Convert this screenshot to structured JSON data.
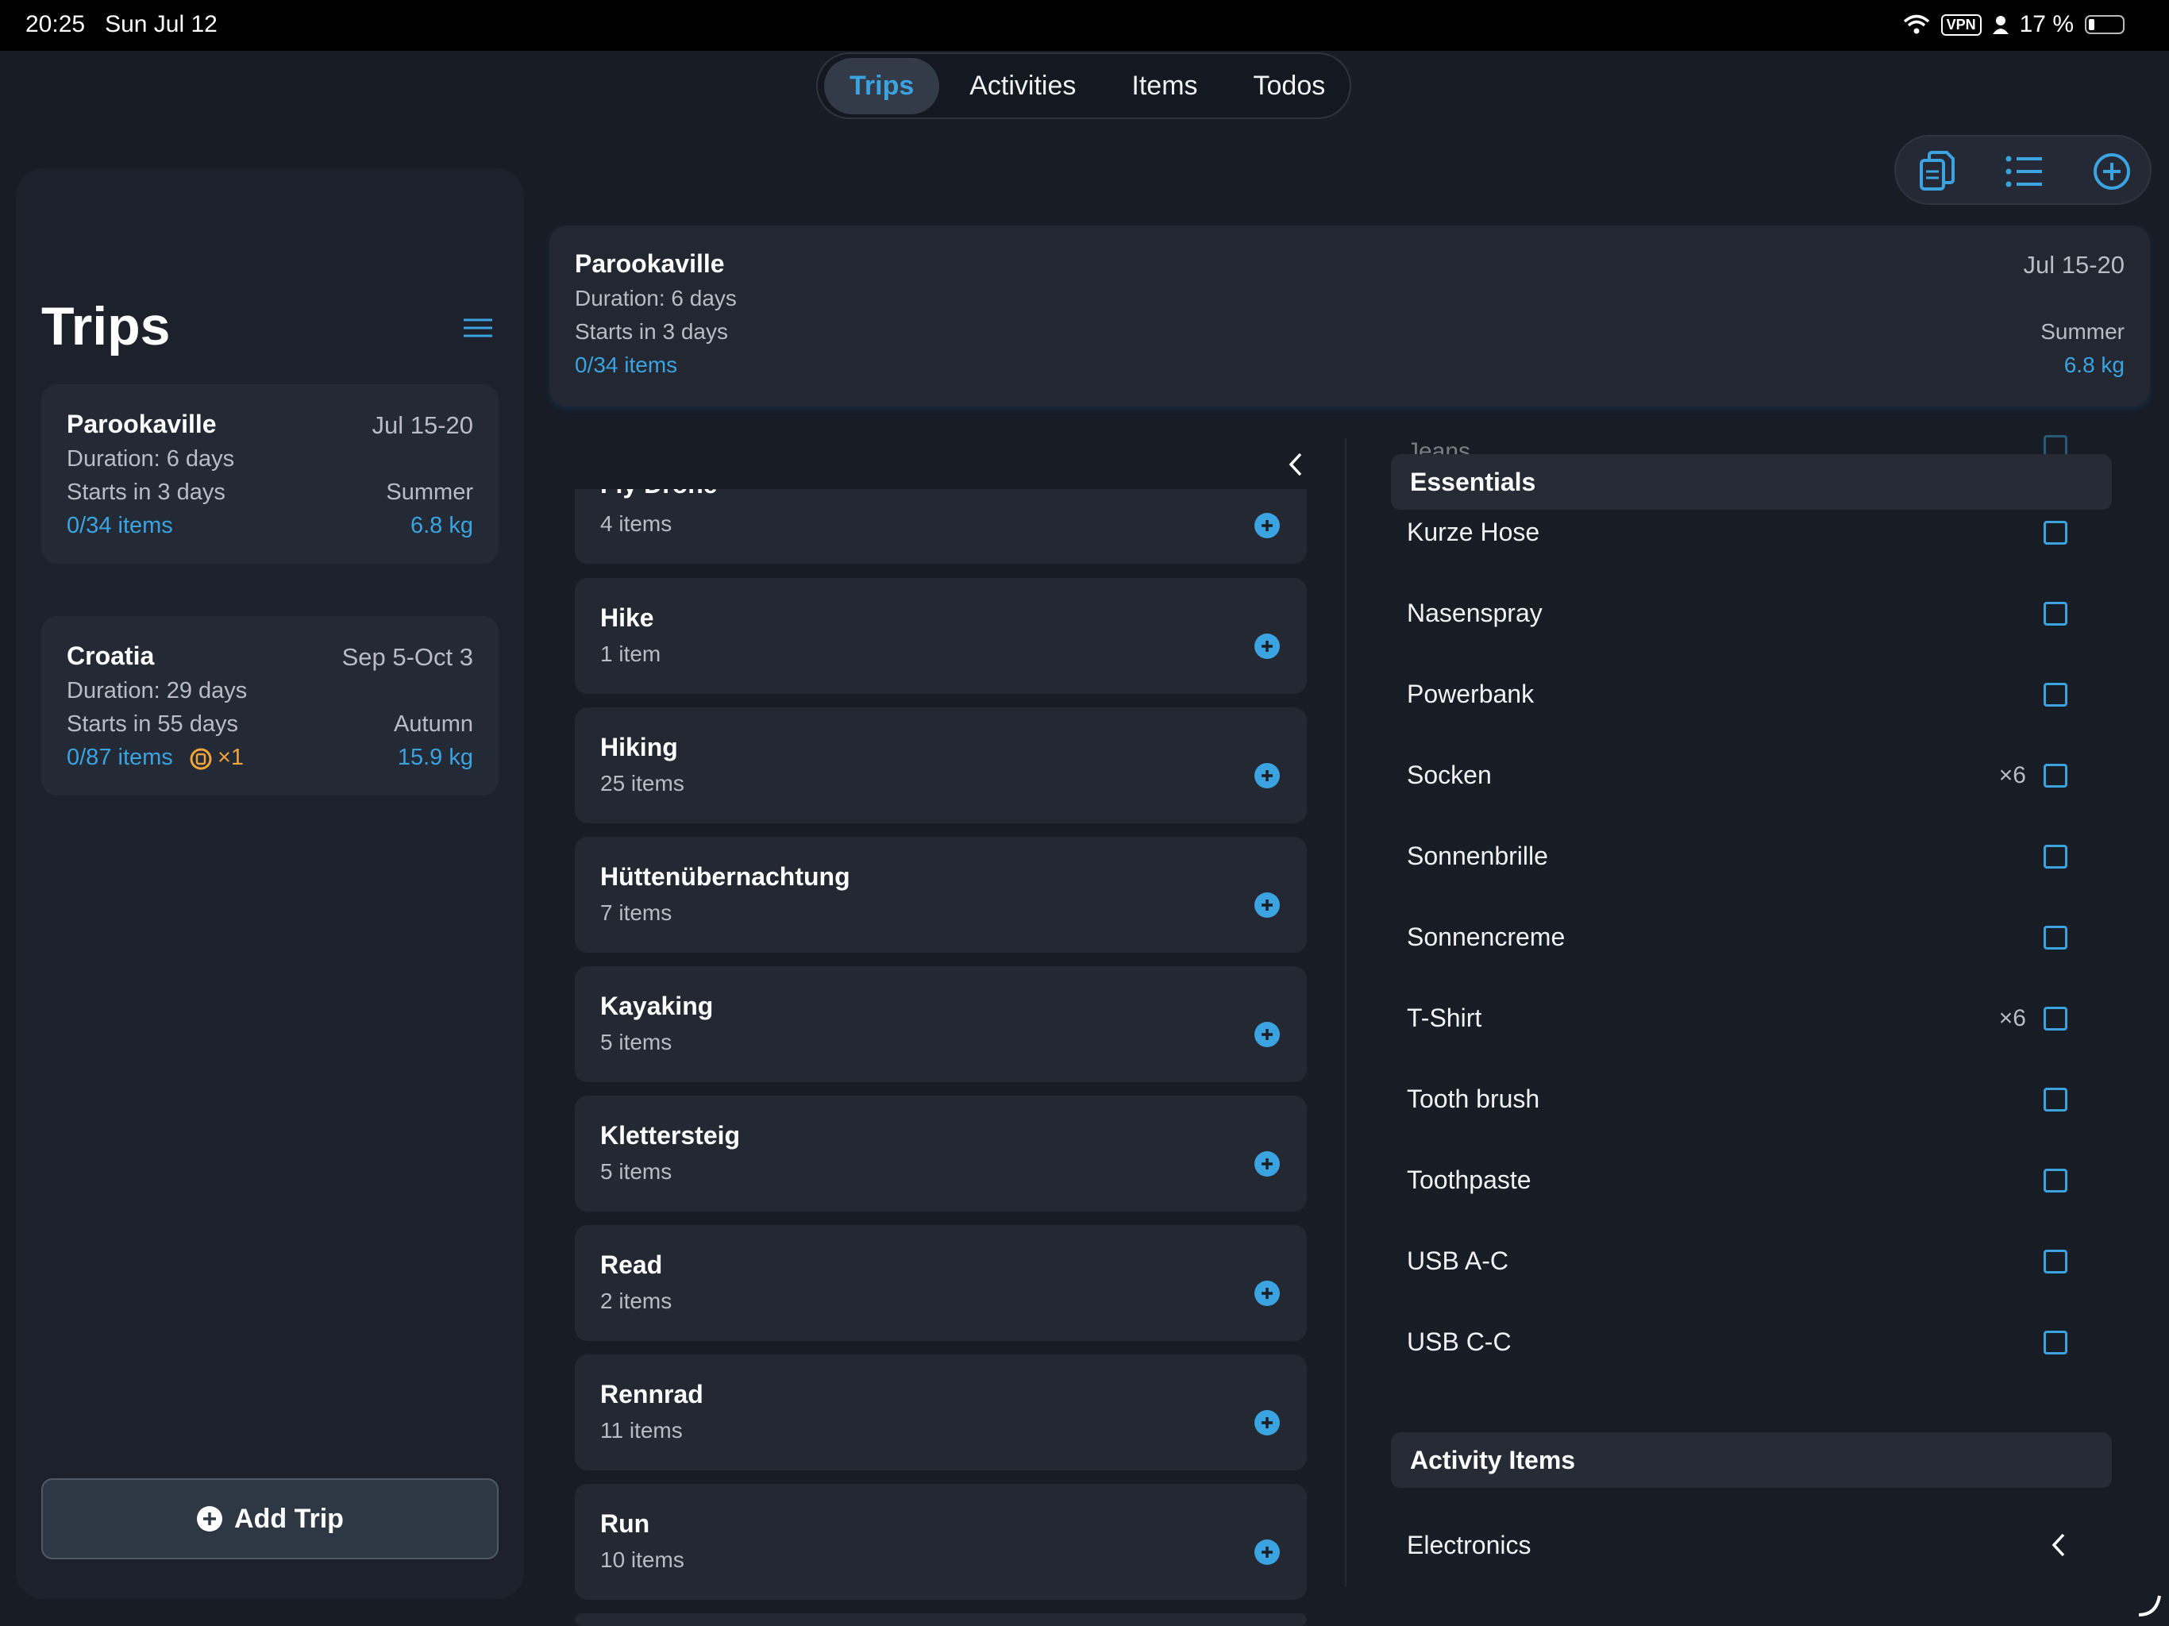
{
  "status_bar": {
    "time": "20:25",
    "date": "Sun Jul 12",
    "vpn": "VPN",
    "battery": "17 %"
  },
  "tabs": [
    {
      "label": "Trips",
      "active": true
    },
    {
      "label": "Activities",
      "active": false
    },
    {
      "label": "Items",
      "active": false
    },
    {
      "label": "Todos",
      "active": false
    }
  ],
  "toolbar": {
    "icons": [
      "copy-documents-icon",
      "list-icon",
      "plus-circle-icon"
    ]
  },
  "sidebar": {
    "title": "Trips",
    "trips": [
      {
        "name": "Parookaville",
        "dates": "Jul 15-20",
        "duration": "Duration: 6 days",
        "starts": "Starts in 3 days",
        "season": "Summer",
        "items": "0/34 items",
        "weight": "6.8 kg"
      },
      {
        "name": "Croatia",
        "dates": "Sep 5-Oct 3",
        "duration": "Duration: 29 days",
        "starts": "Starts in 55 days",
        "season": "Autumn",
        "items": "0/87 items",
        "badge": "×1",
        "weight": "15.9 kg"
      }
    ],
    "add_trip": "Add Trip"
  },
  "detail": {
    "name": "Parookaville",
    "dates": "Jul 15-20",
    "duration": "Duration: 6 days",
    "starts": "Starts in 3 days",
    "items": "0/34 items",
    "season": "Summer",
    "weight": "6.8 kg"
  },
  "activities": [
    {
      "name": "Fly Drone",
      "count": "4 items"
    },
    {
      "name": "Hike",
      "count": "1 item"
    },
    {
      "name": "Hiking",
      "count": "25 items"
    },
    {
      "name": "Hüttenübernachtung",
      "count": "7 items"
    },
    {
      "name": "Kayaking",
      "count": "5 items"
    },
    {
      "name": "Klettersteig",
      "count": "5 items"
    },
    {
      "name": "Read",
      "count": "2 items"
    },
    {
      "name": "Rennrad",
      "count": "11 items"
    },
    {
      "name": "Run",
      "count": "10 items"
    }
  ],
  "items_panel": {
    "scrolled_item": "Jeans",
    "section_essentials": "Essentials",
    "essentials": [
      {
        "name": "Kurze Hose",
        "qty": ""
      },
      {
        "name": "Nasenspray",
        "qty": ""
      },
      {
        "name": "Powerbank",
        "qty": ""
      },
      {
        "name": "Socken",
        "qty": "×6"
      },
      {
        "name": "Sonnenbrille",
        "qty": ""
      },
      {
        "name": "Sonnencreme",
        "qty": ""
      },
      {
        "name": "T-Shirt",
        "qty": "×6"
      },
      {
        "name": "Tooth brush",
        "qty": ""
      },
      {
        "name": "Toothpaste",
        "qty": ""
      },
      {
        "name": "USB A-C",
        "qty": ""
      },
      {
        "name": "USB C-C",
        "qty": ""
      }
    ],
    "section_activity": "Activity Items",
    "activity_groups": [
      {
        "name": "Electronics"
      }
    ]
  },
  "colors": {
    "accent": "#3aa3e0",
    "background": "#181c25",
    "card": "#242a35",
    "warning": "#f2a33a"
  }
}
